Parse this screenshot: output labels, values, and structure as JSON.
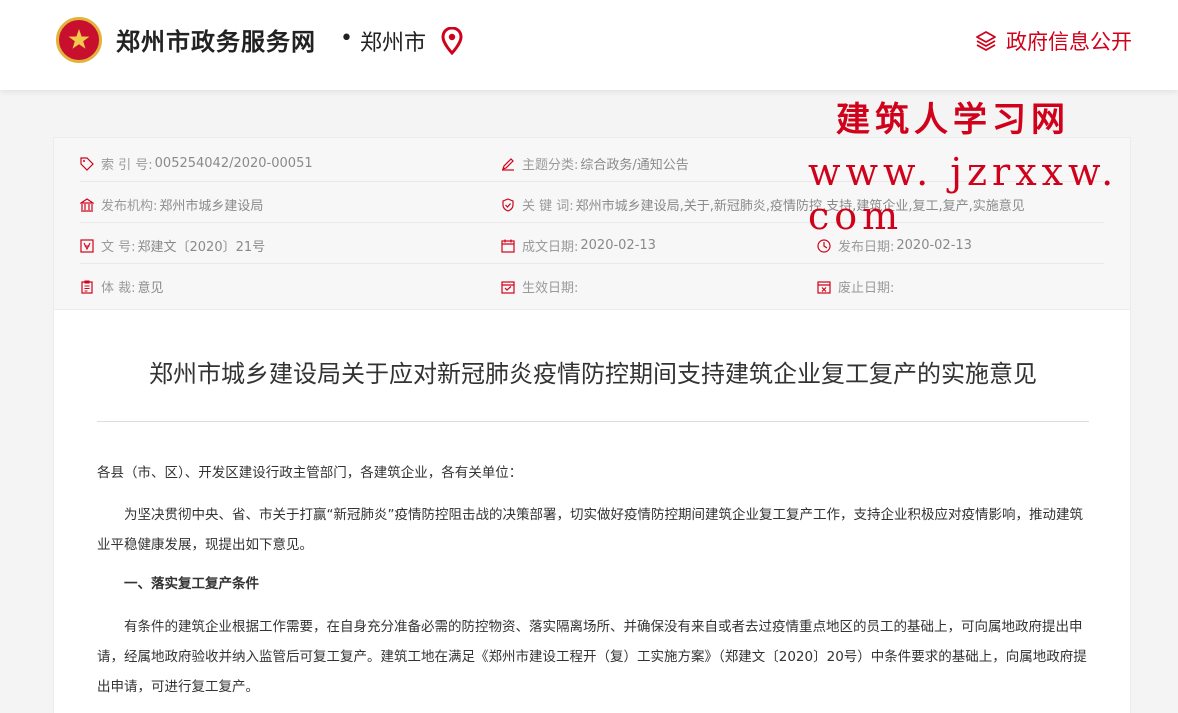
{
  "header": {
    "site_title": "郑州市政务服务网",
    "dot": "•",
    "city": "郑州市",
    "gov_info_label": "政府信息公开"
  },
  "watermark": {
    "line1": "建筑人学习网",
    "line2": "www. jzrxxw. com"
  },
  "meta": {
    "index_label": "索  引  号:",
    "index_value": "005254042/2020-00051",
    "topic_label": "主题分类:",
    "topic_value": "综合政务/通知公告",
    "org_label": "发布机构:",
    "org_value": "郑州市城乡建设局",
    "keywords_label": "关  键  词:",
    "keywords_value": "郑州市城乡建设局,关于,新冠肺炎,疫情防控,支持,建筑企业,复工,复产,实施意见",
    "docno_label": "文        号:",
    "docno_value": "郑建文〔2020〕21号",
    "written_label": "成文日期:",
    "written_value": "2020-02-13",
    "publish_label": "发布日期:",
    "publish_value": "2020-02-13",
    "genre_label": "体        裁:",
    "genre_value": "意见",
    "effective_label": "生效日期:",
    "effective_value": "",
    "expire_label": "废止日期:",
    "expire_value": ""
  },
  "document": {
    "title": "郑州市城乡建设局关于应对新冠肺炎疫情防控期间支持建筑企业复工复产的实施意见",
    "salutation": "各县（市、区）、开发区建设行政主管部门，各建筑企业，各有关单位：",
    "para1": "为坚决贯彻中央、省、市关于打赢“新冠肺炎”疫情防控阻击战的决策部署，切实做好疫情防控期间建筑企业复工复产工作，支持企业积极应对疫情影响，推动建筑业平稳健康发展，现提出如下意见。",
    "heading1": "一、落实复工复产条件",
    "para2": "有条件的建筑企业根据工作需要，在自身充分准备必需的防控物资、落实隔离场所、并确保没有来自或者去过疫情重点地区的员工的基础上，可向属地政府提出申请，经属地政府验收并纳入监管后可复工复产。建筑工地在满足《郑州市建设工程开（复）工实施方案》（郑建文〔2020〕20号）中条件要求的基础上，向属地政府提出申请，可进行复工复产。"
  },
  "colors": {
    "accent": "#d0021b",
    "meta_text": "#9a9a9a"
  }
}
